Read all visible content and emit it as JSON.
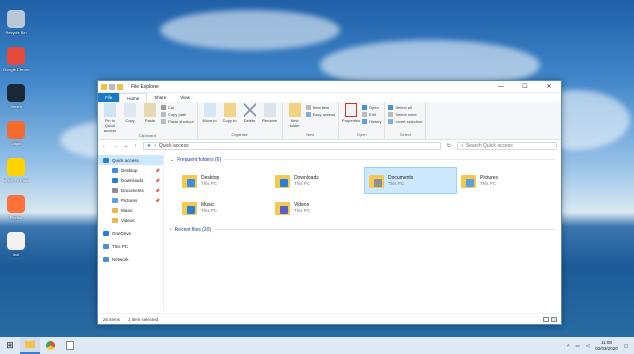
{
  "desktop_icons": [
    {
      "label": "Recycle Bin",
      "icon": "recycle-bin-icon",
      "color": "#b9c7d6"
    },
    {
      "label": "Google Chrome",
      "icon": "chrome-icon",
      "color": "#e64a3b"
    },
    {
      "label": "Steam",
      "icon": "steam-icon",
      "color": "#1b2838"
    },
    {
      "label": "Origin",
      "icon": "origin-icon",
      "color": "#f56c2d"
    },
    {
      "label": "NOW TV Player",
      "icon": "nowtv-icon",
      "color": "#ffd200"
    },
    {
      "label": "Firefox",
      "icon": "firefox-icon",
      "color": "#ff7139"
    },
    {
      "label": "test",
      "icon": "python-file-icon",
      "color": "#f2f2f2"
    }
  ],
  "window": {
    "title": "File Explorer",
    "controls": {
      "minimize": "—",
      "maximize": "☐",
      "close": "✕"
    }
  },
  "tabs": [
    "File",
    "Home",
    "Share",
    "View"
  ],
  "ribbon": {
    "clipboard": {
      "name": "Clipboard",
      "pin": "Pin to Quick access",
      "copy": "Copy",
      "paste": "Paste",
      "cut": "Cut",
      "copy_path": "Copy path",
      "paste_shortcut": "Paste shortcut"
    },
    "organise": {
      "name": "Organise",
      "move": "Move to",
      "copy": "Copy to",
      "delete": "Delete",
      "rename": "Rename"
    },
    "new": {
      "name": "New",
      "new_folder": "New folder",
      "new_item": "New item",
      "easy_access": "Easy access"
    },
    "open": {
      "name": "Open",
      "properties": "Properties",
      "open": "Open",
      "edit": "Edit",
      "history": "History"
    },
    "select": {
      "name": "Select",
      "select_all": "Select all",
      "select_none": "Select none",
      "invert": "Invert selection"
    }
  },
  "address": {
    "path": "Quick access",
    "search_placeholder": "Search Quick access"
  },
  "nav": [
    {
      "label": "Quick access",
      "selected": true,
      "sub": false,
      "pinned": false,
      "color": "#2a7fd4"
    },
    {
      "label": "Desktop",
      "sub": true,
      "pinned": true,
      "color": "#3b8fe0"
    },
    {
      "label": "Downloads",
      "sub": true,
      "pinned": true,
      "color": "#2a7fd4"
    },
    {
      "label": "Documents",
      "sub": true,
      "pinned": true,
      "color": "#8a8f98"
    },
    {
      "label": "Pictures",
      "sub": true,
      "pinned": true,
      "color": "#5aa0e6"
    },
    {
      "label": "Music",
      "sub": true,
      "pinned": false,
      "color": "#e8b84a"
    },
    {
      "label": "Videos",
      "sub": true,
      "pinned": false,
      "color": "#e8b84a"
    },
    {
      "label": "OneDrive",
      "sub": false,
      "pinned": false,
      "color": "#2c7be5"
    },
    {
      "label": "This PC",
      "sub": false,
      "pinned": false,
      "color": "#4a90d9"
    },
    {
      "label": "Network",
      "sub": false,
      "pinned": false,
      "color": "#4a90d9"
    }
  ],
  "frequent": {
    "heading": "Frequent folders (6)",
    "items": [
      {
        "name": "Desktop",
        "loc": "This PC",
        "selected": false,
        "badge": "#3b8fe0"
      },
      {
        "name": "Downloads",
        "loc": "This PC",
        "selected": false,
        "badge": "#2a7fd4"
      },
      {
        "name": "Documents",
        "loc": "This PC",
        "selected": true,
        "badge": "#8a8f98"
      },
      {
        "name": "Pictures",
        "loc": "This PC",
        "selected": false,
        "badge": "#5aa0e6"
      },
      {
        "name": "Music",
        "loc": "This PC",
        "selected": false,
        "badge": "#2a7fd4"
      },
      {
        "name": "Videos",
        "loc": "This PC",
        "selected": false,
        "badge": "#5b5fc7"
      }
    ]
  },
  "recent": {
    "heading": "Recent files (20)"
  },
  "status": {
    "items": "26 items",
    "selected": "1 item selected"
  },
  "taskbar": {
    "time": "11:08",
    "date": "02/03/2020"
  }
}
